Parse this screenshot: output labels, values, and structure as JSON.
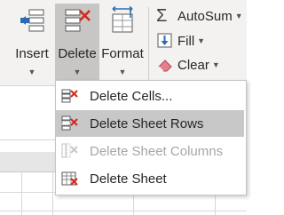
{
  "ribbon": {
    "insert": {
      "label": "Insert",
      "icon": "insert-cells-icon"
    },
    "delete": {
      "label": "Delete",
      "icon": "delete-cells-icon"
    },
    "format": {
      "label": "Format",
      "icon": "format-cells-icon"
    },
    "autosum": {
      "label": "AutoSum",
      "icon": "sigma-icon"
    },
    "fill": {
      "label": "Fill",
      "icon": "fill-down-icon"
    },
    "clear": {
      "label": "Clear",
      "icon": "eraser-icon"
    }
  },
  "delete_menu": {
    "items": [
      {
        "label": "Delete Cells...",
        "icon": "delete-cells-icon",
        "state": "enabled"
      },
      {
        "label": "Delete Sheet Rows",
        "icon": "delete-rows-icon",
        "state": "highlighted"
      },
      {
        "label": "Delete Sheet Columns",
        "icon": "delete-columns-icon",
        "state": "disabled"
      },
      {
        "label": "Delete Sheet",
        "icon": "delete-sheet-icon",
        "state": "enabled"
      }
    ]
  },
  "colors": {
    "ribbon_bg": "#f3f2f1",
    "pressed_bg": "#c8c6c4",
    "highlight_bg": "#c8c8c8",
    "delete_red": "#d0291c",
    "icon_blue": "#2b6cb0",
    "disabled_text": "#a6a6a6"
  }
}
